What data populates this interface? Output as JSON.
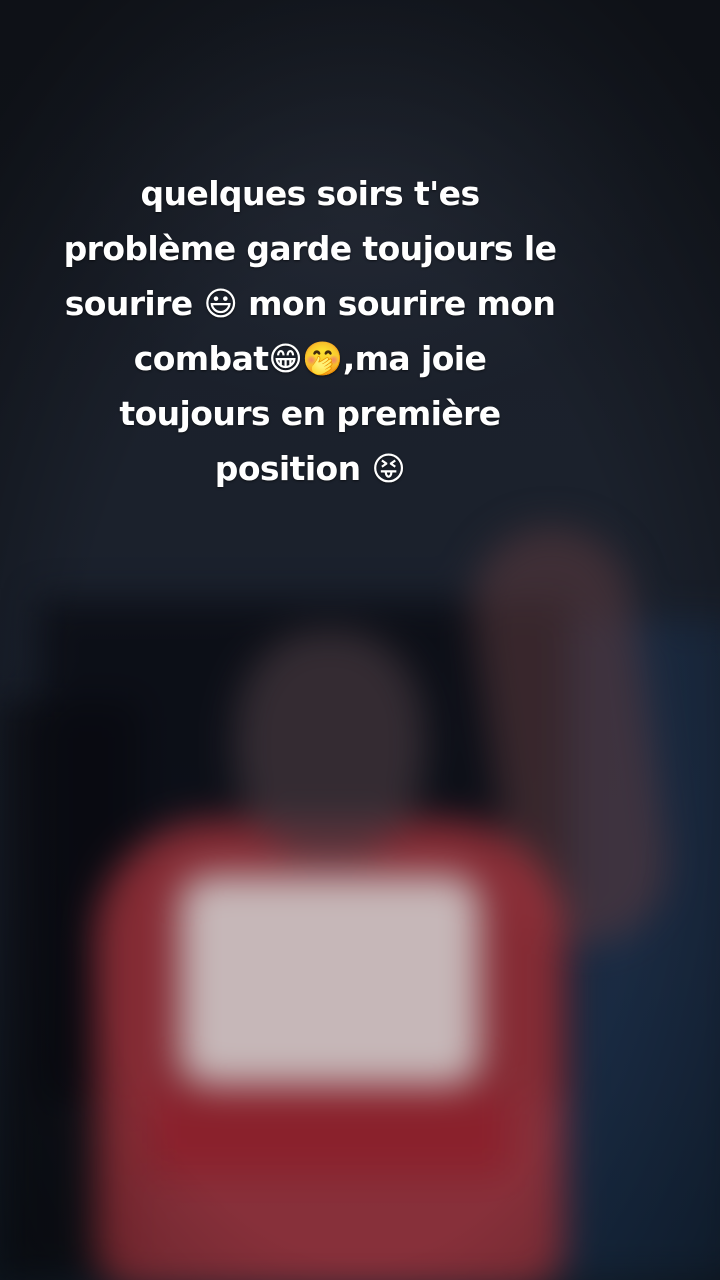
{
  "caption": {
    "lines": [
      "quelques soirs t'es",
      "problème garde toujours le",
      "sourire 😃 mon sourire mon",
      "combat😁🤭,ma joie",
      "toujours en première",
      "position 😝"
    ]
  },
  "colors": {
    "background": "#1a1f29",
    "caption_text": "#ffffff",
    "shirt": "#a8343e",
    "shirt_print": "#cdc6c6"
  }
}
